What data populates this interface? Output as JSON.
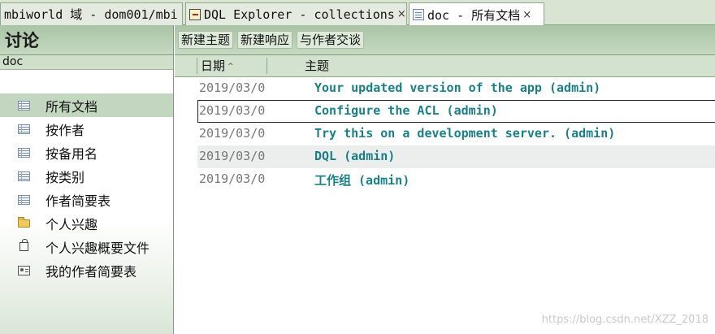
{
  "tabs": [
    {
      "label": "mbiworld 域 - dom001/mbi",
      "icon": "none",
      "active": false,
      "closable": false
    },
    {
      "label": "DQL Explorer - collections",
      "icon": "dql-icon",
      "active": false,
      "closable": true
    },
    {
      "label": "doc - 所有文档",
      "icon": "document-icon",
      "active": true,
      "closable": true
    }
  ],
  "close_glyph": "×",
  "sidebar": {
    "title": "讨论",
    "database": "doc",
    "items": [
      {
        "label": "所有文档",
        "icon": "view-icon",
        "selected": true
      },
      {
        "label": "按作者",
        "icon": "view-icon",
        "selected": false
      },
      {
        "label": "按备用名",
        "icon": "view-icon",
        "selected": false
      },
      {
        "label": "按类别",
        "icon": "view-icon",
        "selected": false
      },
      {
        "label": "作者简要表",
        "icon": "view-icon",
        "selected": false
      },
      {
        "label": "个人兴趣",
        "icon": "folder-icon",
        "selected": false
      },
      {
        "label": "个人兴趣概要文件",
        "icon": "lock-icon",
        "selected": false
      },
      {
        "label": "我的作者简要表",
        "icon": "person-icon",
        "selected": false
      }
    ]
  },
  "toolbar": {
    "new_topic": "新建主题",
    "new_response": "新建响应",
    "chat_author": "与作者交谈"
  },
  "columns": {
    "date": "日期",
    "date_sort": "^",
    "subject": "主题"
  },
  "documents": [
    {
      "date": "2019/03/0",
      "subject": "Your updated version of the app (admin)"
    },
    {
      "date": "2019/03/0",
      "subject": "Configure the ACL (admin)"
    },
    {
      "date": "2019/03/0",
      "subject": "Try this on a development server. (admin)"
    },
    {
      "date": "2019/03/0",
      "subject": "DQL (admin)"
    },
    {
      "date": "2019/03/0",
      "subject": "工作组 (admin)"
    }
  ],
  "watermark": "https://blog.csdn.net/XZZ_2018"
}
